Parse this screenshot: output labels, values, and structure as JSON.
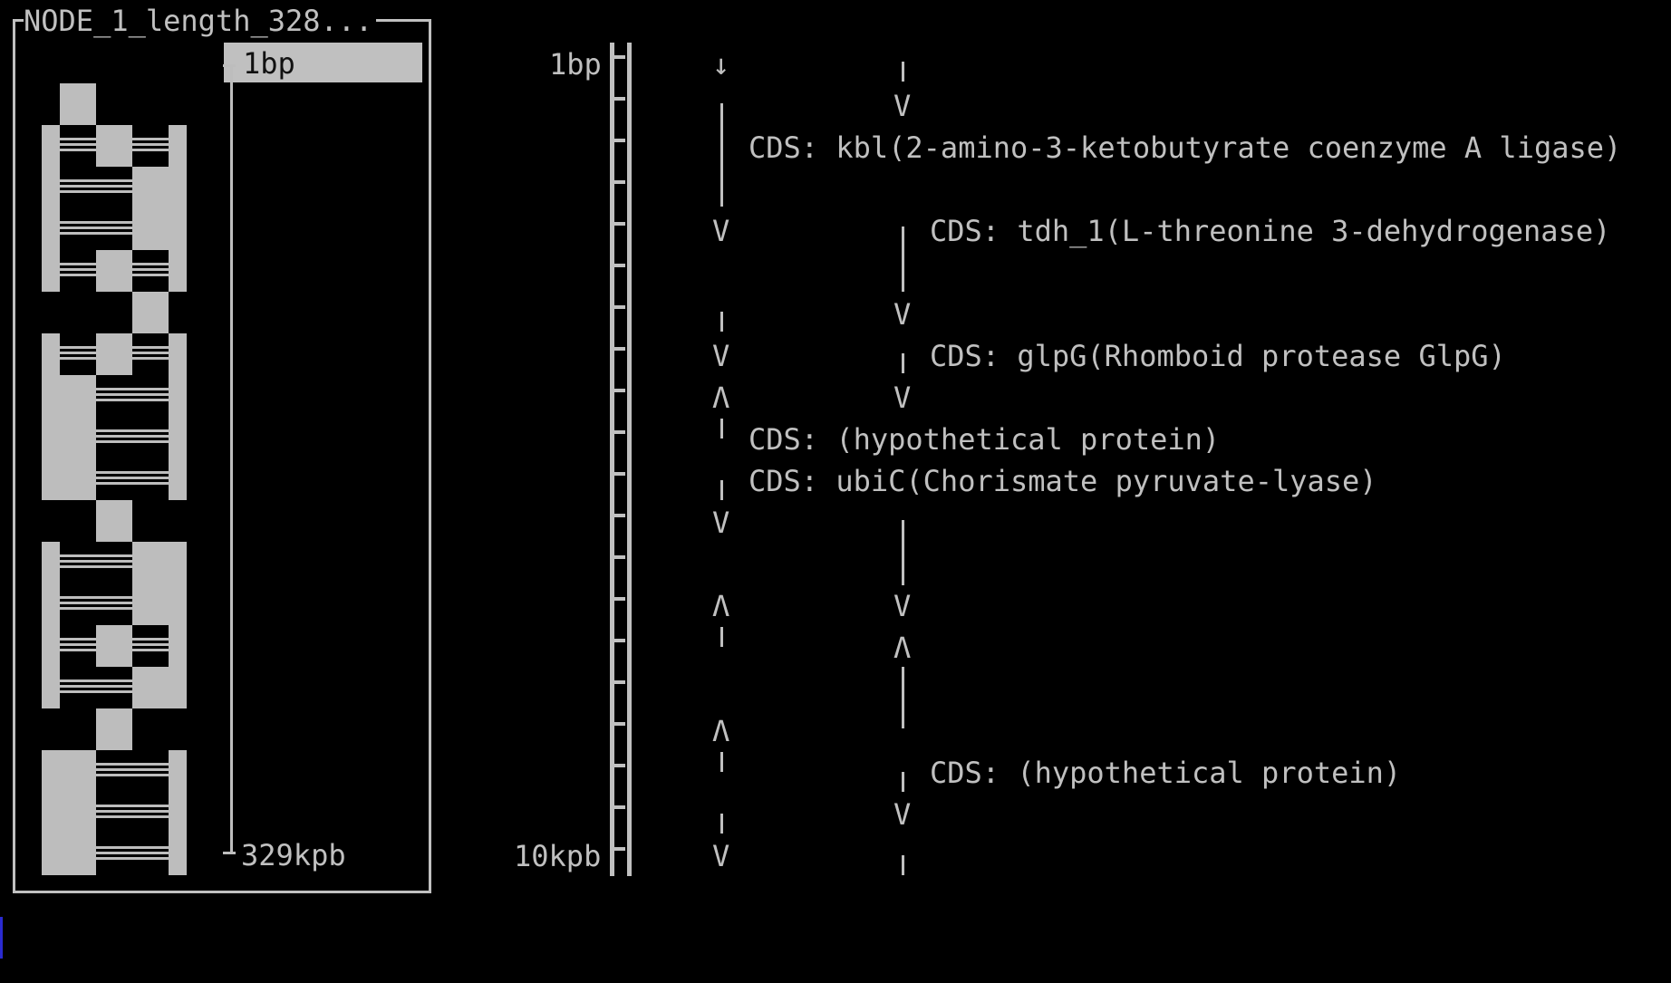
{
  "node_panel": {
    "title": "NODE_1_length_328...",
    "range_start": "1bp",
    "range_end": "329kpb"
  },
  "ruler": {
    "start_label": "1bp",
    "end_label": "10kpb"
  },
  "features": [
    {
      "label": "CDS: kbl(2-amino-3-ketobutyrate coenzyme A ligase)"
    },
    {
      "label": "CDS: tdh_1(L-threonine 3-dehydrogenase)"
    },
    {
      "label": "CDS: glpG(Rhomboid protease GlpG)"
    },
    {
      "label": "CDS: (hypothetical protein)"
    },
    {
      "label": "CDS: ubiC(Chorismate pyruvate-lyase)"
    },
    {
      "label": "CDS: (hypothetical protein)"
    }
  ],
  "glyphs": {
    "down_arrow": "↓",
    "v": "V",
    "caret": "Λ"
  },
  "colors": {
    "background": "#000000",
    "foreground": "#c0c0c0",
    "cursor": "#2a2ad0"
  }
}
